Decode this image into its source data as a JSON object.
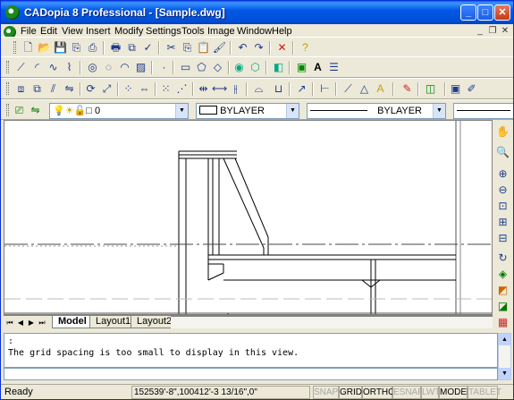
{
  "window": {
    "title": "CADopia 8 Professional  - [Sample.dwg]"
  },
  "menu": [
    "File",
    "Edit",
    "View",
    "Insert",
    "Modify",
    "Settings",
    "Tools",
    "Image",
    "Window",
    "Help"
  ],
  "properties": {
    "layer": "0",
    "color": "BYLAYER",
    "linetype": "BYLAYER"
  },
  "layout_tabs": [
    "Model",
    "Layout1",
    "Layout2"
  ],
  "command": {
    "prompt": ":",
    "message": "The grid spacing is too small to display in this view."
  },
  "status": {
    "ready": "Ready",
    "coords": "152539'-8\",100412'-3 13/16\",0\"",
    "toggles": [
      {
        "label": "SNAP",
        "on": false
      },
      {
        "label": "GRID",
        "on": true
      },
      {
        "label": "ORTHO",
        "on": true
      },
      {
        "label": "ESNAP",
        "on": false
      },
      {
        "label": "LWT",
        "on": false
      },
      {
        "label": "MODEL",
        "on": true
      },
      {
        "label": "TABLET",
        "on": false
      }
    ]
  },
  "icons": {
    "toolbar1": [
      "new-icon",
      "open-icon",
      "save-icon",
      "print-preview-icon",
      "plot-icon",
      "cut-icon",
      "copy-icon",
      "paste-icon",
      "match-properties-icon",
      "undo-icon",
      "redo-icon",
      "delete-icon",
      "help-icon"
    ],
    "toolbar2": [
      "line-icon",
      "arc-icon",
      "spline-icon",
      "polyline-icon",
      "circle-icon",
      "ellipse-icon",
      "hatch-icon",
      "point-icon",
      "rectangle-icon",
      "polygon-icon",
      "donut-icon",
      "region-icon",
      "block-icon",
      "image-icon",
      "text-icon",
      "mtext-icon"
    ],
    "toolbar3": [
      "move-icon",
      "copy-object-icon",
      "offset-icon",
      "mirror-icon",
      "rotate-icon",
      "scale-icon",
      "stretch-icon",
      "array-icon",
      "trim-icon",
      "extend-icon",
      "break-icon",
      "chamfer-icon",
      "fillet-icon",
      "explode-icon",
      "dimension-icon",
      "leader-icon",
      "tolerance-icon",
      "edit-icon",
      "properties-icon"
    ],
    "right": [
      "pan-icon",
      "zoom-realtime-icon",
      "zoom-in-icon",
      "zoom-out-icon",
      "zoom-window-icon",
      "zoom-extents-icon",
      "zoom-previous-icon",
      "redraw-icon",
      "view-icon",
      "shade-icon",
      "render-icon",
      "viewport-icon"
    ]
  }
}
